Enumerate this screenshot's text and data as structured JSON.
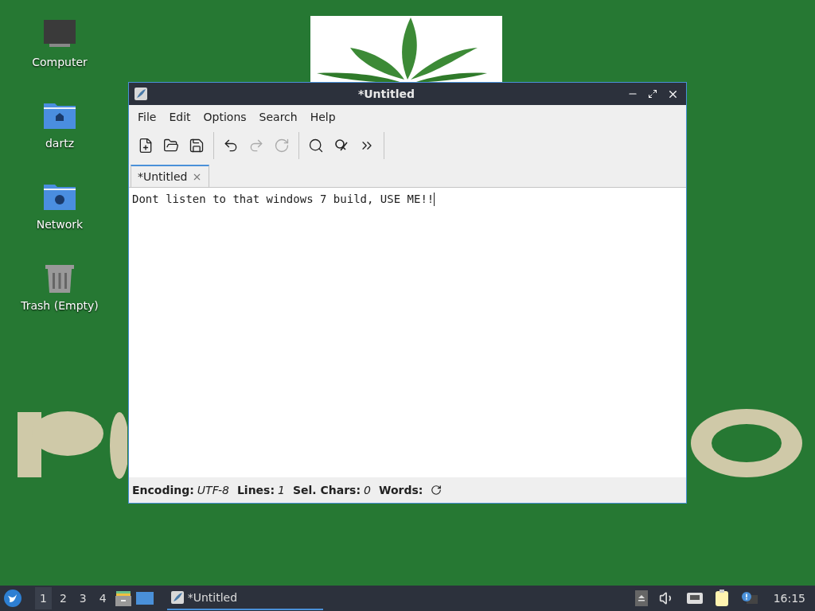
{
  "desktop_icons": [
    {
      "label": "Computer",
      "kind": "computer"
    },
    {
      "label": "dartz",
      "kind": "home"
    },
    {
      "label": "Network",
      "kind": "network"
    },
    {
      "label": "Trash (Empty)",
      "kind": "trash"
    }
  ],
  "window": {
    "title": "*Untitled"
  },
  "menu": [
    "File",
    "Edit",
    "Options",
    "Search",
    "Help"
  ],
  "toolbar": [
    {
      "kind": "new",
      "disabled": false
    },
    {
      "kind": "open",
      "disabled": false
    },
    {
      "kind": "save",
      "disabled": false
    },
    {
      "kind": "separator"
    },
    {
      "kind": "undo",
      "disabled": false
    },
    {
      "kind": "redo",
      "disabled": true
    },
    {
      "kind": "reload",
      "disabled": true
    },
    {
      "kind": "separator"
    },
    {
      "kind": "find",
      "disabled": false
    },
    {
      "kind": "replace",
      "disabled": false
    },
    {
      "kind": "jump",
      "disabled": false
    },
    {
      "kind": "separator"
    }
  ],
  "tabs": [
    {
      "label": "*Untitled",
      "selected": true
    }
  ],
  "editor": {
    "text": "Dont listen to that windows 7 build, USE ME!!"
  },
  "status_bar": [
    {
      "label": "Encoding:",
      "value": "UTF-8"
    },
    {
      "label": "Lines:",
      "value": "1"
    },
    {
      "label": "Sel. Chars:",
      "value": "0"
    },
    {
      "label": "Words:"
    }
  ],
  "taskbar": {
    "workspaces": [
      {
        "label": "1",
        "selected": true
      },
      {
        "label": "2",
        "selected": false
      },
      {
        "label": "3",
        "selected": false
      },
      {
        "label": "4",
        "selected": false
      }
    ],
    "tasks": [
      {
        "label": "*Untitled",
        "selected": true
      }
    ],
    "clock": "16:15"
  }
}
